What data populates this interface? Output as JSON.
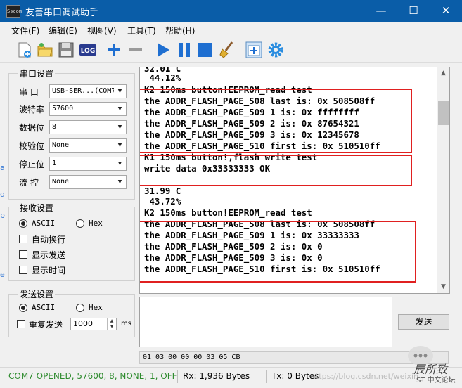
{
  "window": {
    "title": "友善串口调试助手",
    "app_icon_text": "Sscom",
    "minimize_glyph": "—",
    "maximize_glyph": "☐",
    "close_glyph": "✕"
  },
  "menu": {
    "items": [
      "文件(F)",
      "编辑(E)",
      "视图(V)",
      "工具(T)",
      "帮助(H)"
    ]
  },
  "toolbar": {
    "icons": [
      "new-file-icon",
      "open-folder-icon",
      "save-icon",
      "log-icon",
      "zoom-in-icon",
      "zoom-out-icon",
      "play-icon",
      "pause-icon",
      "stop-icon",
      "clear-broom-icon",
      "add-window-icon",
      "settings-gear-icon"
    ],
    "log_text": "LOG"
  },
  "serial_settings": {
    "group_label": "串口设置",
    "port_label": "串  口",
    "port_value": "USB-SER...(COM7",
    "baud_label": "波特率",
    "baud_value": "57600",
    "databits_label": "数据位",
    "databits_value": "8",
    "parity_label": "校验位",
    "parity_value": "None",
    "stopbits_label": "停止位",
    "stopbits_value": "1",
    "flow_label": "流  控",
    "flow_value": "None"
  },
  "receive_settings": {
    "group_label": "接收设置",
    "ascii_label": "ASCII",
    "hex_label": "Hex",
    "ascii_selected": true,
    "auto_wrap_label": "自动换行",
    "show_send_label": "显示发送",
    "show_time_label": "显示时间"
  },
  "send_settings": {
    "group_label": "发送设置",
    "ascii_label": "ASCII",
    "hex_label": "Hex",
    "ascii_selected": true,
    "repeat_label": "重复发送",
    "interval_value": "1000",
    "interval_unit": "ms"
  },
  "receive_lines": [
    "32.01 C",
    " 44.12%",
    "K2 150ms button!EEPROM_read test",
    "the ADDR_FLASH_PAGE_508 last is: 0x 508508ff",
    "the ADDR_FLASH_PAGE_509 1 is: 0x ffffffff",
    "the ADDR_FLASH_PAGE_509 2 is: 0x 87654321",
    "the ADDR_FLASH_PAGE_509 3 is: 0x 12345678",
    "the ADDR_FLASH_PAGE_510 first is: 0x 510510ff",
    "K1 150ms button!,flash write test",
    "write data 0x33333333 OK",
    "",
    "31.99 C",
    " 43.72%",
    "K2 150ms button!EEPROM_read test",
    "the ADDR_FLASH_PAGE_508 last is: 0x 508508ff",
    "the ADDR_FLASH_PAGE_509 1 is: 0x 33333333",
    "the ADDR_FLASH_PAGE_509 2 is: 0x 0",
    "the ADDR_FLASH_PAGE_509 3 is: 0x 0",
    "the ADDR_FLASH_PAGE_510 first is: 0x 510510ff"
  ],
  "send": {
    "button_label": "发送",
    "hex_data": "01 03 00 00 00 03 05 CB"
  },
  "status": {
    "port_status": "COM7 OPENED, 57600, 8, NONE, 1, OFF",
    "rx": "Rx: 1,936 Bytes",
    "tx": "Tx: 0 Bytes",
    "watermark_url": "https://blog.csdn.net/weixin_",
    "watermark_brand": "辰所致",
    "watermark_sub": "ST 中文论坛"
  },
  "colors": {
    "titlebar": "#0a5da8",
    "status_text": "#2e8b2e",
    "highlight_box": "#e02020",
    "toolbar_blue": "#1f6fd1"
  }
}
